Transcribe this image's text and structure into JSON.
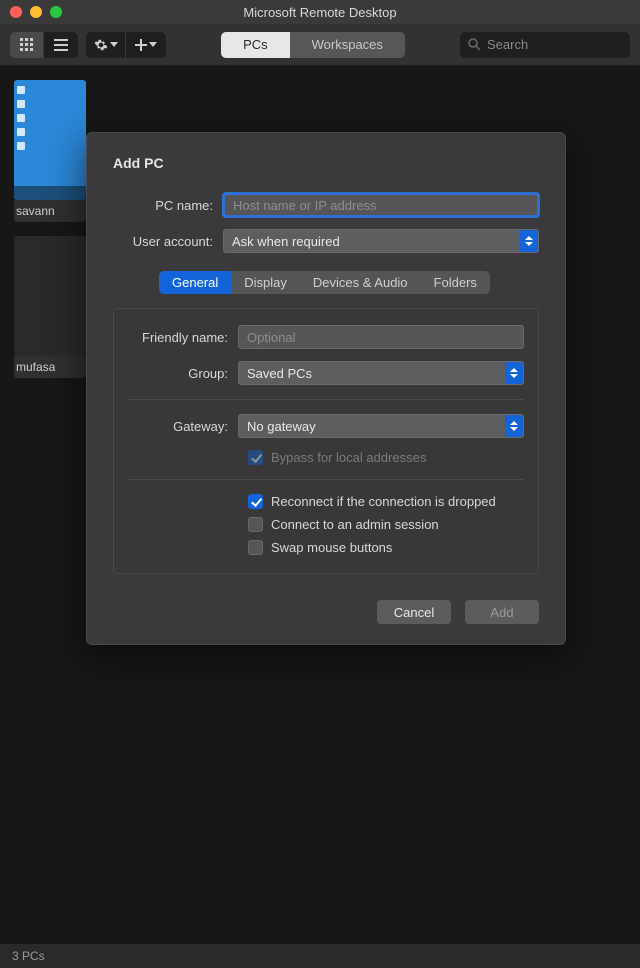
{
  "window": {
    "title": "Microsoft Remote Desktop"
  },
  "toolbar": {
    "tabs": {
      "pcs": "PCs",
      "workspaces": "Workspaces"
    },
    "search_placeholder": "Search"
  },
  "pcs": {
    "card1": "savann",
    "card2": "mufasa"
  },
  "sheet": {
    "title": "Add PC",
    "labels": {
      "pc_name": "PC name:",
      "user_account": "User account:",
      "friendly_name": "Friendly name:",
      "group": "Group:",
      "gateway": "Gateway:"
    },
    "pc_name_placeholder": "Host name or IP address",
    "user_account_value": "Ask when required",
    "friendly_name_placeholder": "Optional",
    "group_value": "Saved PCs",
    "gateway_value": "No gateway",
    "tabs": {
      "general": "General",
      "display": "Display",
      "devices": "Devices & Audio",
      "folders": "Folders"
    },
    "checks": {
      "bypass": "Bypass for local addresses",
      "reconnect": "Reconnect if the connection is dropped",
      "admin": "Connect to an admin session",
      "swap": "Swap mouse buttons"
    },
    "buttons": {
      "cancel": "Cancel",
      "add": "Add"
    }
  },
  "status": {
    "count": "3 PCs"
  }
}
